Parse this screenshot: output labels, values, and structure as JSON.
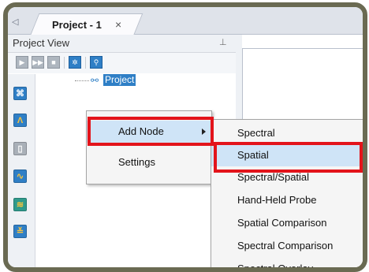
{
  "tabs": {
    "scroll_glyph": "◁",
    "active_label": "Project - 1",
    "close_glyph": "×"
  },
  "project_view": {
    "title": "Project View",
    "pin_glyph": "📌",
    "toolbar_icons": [
      "play-icon",
      "step-forward-icon",
      "stop-icon",
      "settings-icon",
      "search-icon"
    ],
    "side_icons": [
      "project-node-icon",
      "spectral-node-icon",
      "blank-node-icon",
      "spectrum-node-icon",
      "spatial-node-icon",
      "overlay-node-icon"
    ],
    "tree_root_label": "Project"
  },
  "context_menu": {
    "items": [
      {
        "label": "Add Node",
        "has_submenu": true
      },
      {
        "label": "Settings",
        "has_submenu": false
      }
    ]
  },
  "submenu": {
    "items": [
      "Spectral",
      "Spatial",
      "Spectral/Spatial",
      "Hand-Held Probe",
      "Spatial Comparison",
      "Spectral Comparison",
      "Spectral Overlay"
    ]
  },
  "colors": {
    "accent": "#2f7fc6",
    "highlight": "#e3141b",
    "frame": "#6a6a52",
    "menu_hover": "#cfe4f7"
  }
}
